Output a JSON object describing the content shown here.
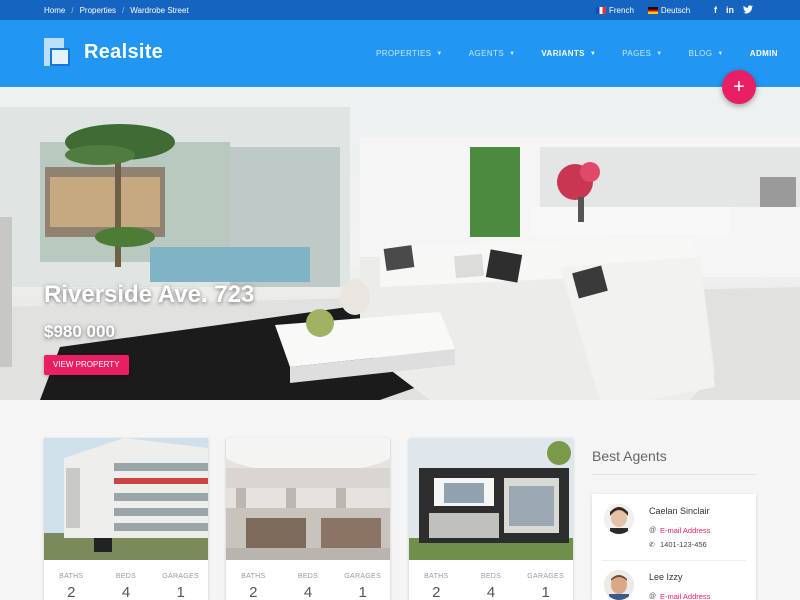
{
  "topbar": {
    "breadcrumbs": [
      "Home",
      "Properties",
      "Wardrobe Street"
    ],
    "languages": [
      {
        "label": "French",
        "flag": "flag-fr-icon"
      },
      {
        "label": "Deutsch",
        "flag": "flag-de-icon"
      }
    ],
    "socials": [
      "f",
      "in",
      "t"
    ]
  },
  "header": {
    "brand": "Realsite",
    "nav": [
      {
        "label": "PROPERTIES",
        "dropdown": true
      },
      {
        "label": "AGENTS",
        "dropdown": true
      },
      {
        "label": "VARIANTS",
        "dropdown": true
      },
      {
        "label": "PAGES",
        "dropdown": true
      },
      {
        "label": "BLOG",
        "dropdown": true
      },
      {
        "label": "ADMIN",
        "dropdown": false
      }
    ],
    "fab": "+"
  },
  "hero": {
    "title": "Riverside Ave. 723",
    "price": "$980 000",
    "button": "VIEW PROPERTY"
  },
  "cards": [
    {
      "baths_label": "BATHS",
      "baths": "2",
      "beds_label": "BEDS",
      "beds": "4",
      "garages_label": "GARAGES",
      "garages": "1"
    },
    {
      "baths_label": "BATHS",
      "baths": "2",
      "beds_label": "BEDS",
      "beds": "4",
      "garages_label": "GARAGES",
      "garages": "1"
    },
    {
      "baths_label": "BATHS",
      "baths": "2",
      "beds_label": "BEDS",
      "beds": "4",
      "garages_label": "GARAGES",
      "garages": "1"
    }
  ],
  "sidebar": {
    "title": "Best Agents",
    "agents": [
      {
        "name": "Caelan Sinclair",
        "email": "E-mail Address",
        "phone": "1401-123-456"
      },
      {
        "name": "Lee Izzy",
        "email": "E-mail Address",
        "phone": ""
      }
    ]
  },
  "colors": {
    "primary": "#2196f3",
    "dark": "#1565c0",
    "accent": "#e91e63"
  }
}
